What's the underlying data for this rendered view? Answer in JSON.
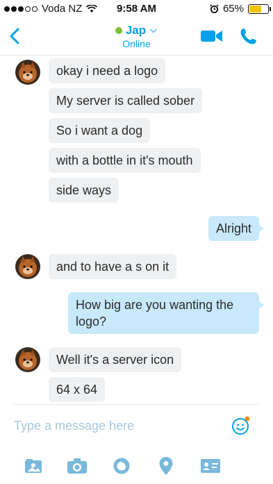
{
  "status_bar": {
    "carrier": "Voda NZ",
    "time": "9:58 AM",
    "battery": "65%",
    "battery_level": 0.65,
    "icons": [
      "signal-dots-icon",
      "wifi-icon",
      "alarm-icon",
      "battery-icon"
    ]
  },
  "header": {
    "contact_name": "Jap",
    "status": "Online",
    "icons": [
      "back-chevron-icon",
      "presence-dot-icon",
      "chevron-down-icon",
      "video-call-icon",
      "phone-icon"
    ]
  },
  "messages": [
    {
      "direction": "in",
      "text": "okay i need a logo",
      "avatar": true
    },
    {
      "direction": "in",
      "text": "My server is called sober"
    },
    {
      "direction": "in",
      "text": "So i want a dog"
    },
    {
      "direction": "in",
      "text": "with a bottle in it's mouth"
    },
    {
      "direction": "in",
      "text": "side ways"
    },
    {
      "direction": "out",
      "text": "Alright"
    },
    {
      "direction": "in",
      "text": "and to have a s on it",
      "avatar": true
    },
    {
      "direction": "out",
      "text": "How big are you wanting the logo?"
    },
    {
      "direction": "in",
      "text": "Well it's a server icon",
      "avatar": true
    },
    {
      "direction": "in",
      "text": "64 x 64"
    }
  ],
  "composer": {
    "placeholder": "Type a message here",
    "icons": [
      "emoji-icon",
      "media-icon",
      "camera-icon",
      "mojis-icon",
      "location-icon",
      "contact-card-icon"
    ]
  },
  "colors": {
    "accent": "#00a1e6",
    "presence": "#7fbf3f",
    "incoming_bubble": "#eef0f2",
    "outgoing_bubble": "#c7e9fb",
    "battery_fill": "#f5c400",
    "notification_dot": "#ff8c1a"
  }
}
